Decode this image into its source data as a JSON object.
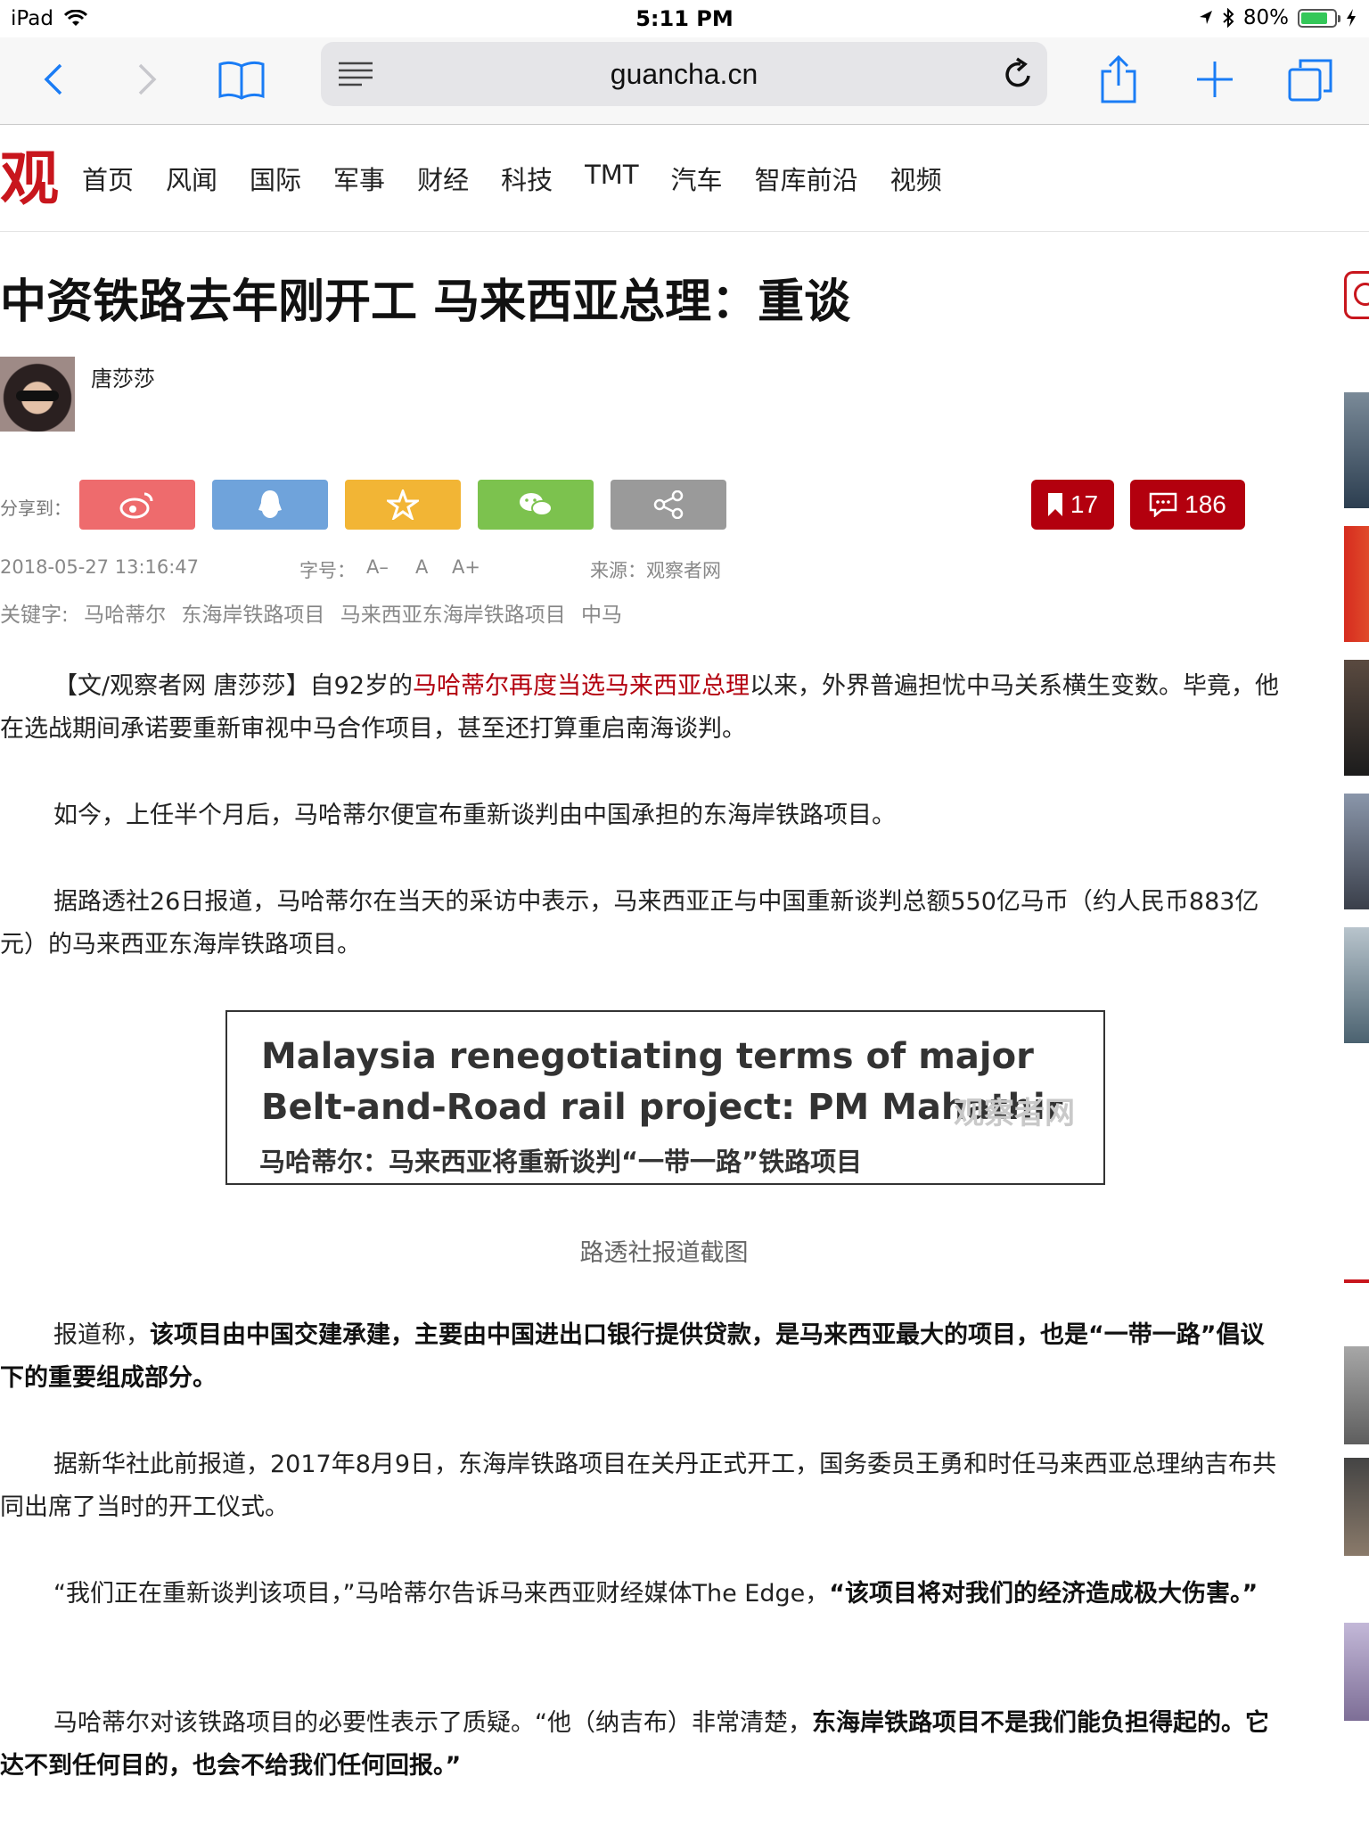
{
  "status_bar": {
    "device": "iPad",
    "time": "5:11 PM",
    "battery": "80%"
  },
  "browser": {
    "url": "guancha.cn"
  },
  "site": {
    "logo_text": "观",
    "nav": [
      "首页",
      "风闻",
      "国际",
      "军事",
      "财经",
      "科技",
      "TMT",
      "汽车",
      "智库前沿",
      "视频"
    ]
  },
  "article": {
    "title": "中资铁路去年刚开工 马来西亚总理：重谈",
    "author": "唐莎莎",
    "share_label": "分享到：",
    "bookmark_count": "17",
    "comment_count": "186",
    "date": "2018-05-27 13:16:47",
    "font_label": "字号：",
    "font_smaller": "A–",
    "font_normal": "A",
    "font_larger": "A+",
    "source": "来源：观察者网",
    "keywords_label": "关键字:",
    "keywords": [
      "马哈蒂尔",
      "东海岸铁路项目",
      "马来西亚东海岸铁路项目",
      "中马"
    ],
    "p1_a": "【文/观察者网 唐莎莎】自92岁的",
    "p1_link": "马哈蒂尔再度当选马来西亚总理",
    "p1_b": "以来，外界普遍担忧中马关系横生变数。毕竟，他在选战期间承诺要重新审视中马合作项目，甚至还打算重启南海谈判。",
    "p2": "如今，上任半个月后，马哈蒂尔便宣布重新谈判由中国承担的东海岸铁路项目。",
    "p3": "据路透社26日报道，马哈蒂尔在当天的采访中表示，马来西亚正与中国重新谈判总额550亿马币（约人民币883亿元）的马来西亚东海岸铁路项目。",
    "figure_en": "Malaysia renegotiating terms of major Belt-and-Road rail project: PM Mahathir",
    "figure_cn": "马哈蒂尔：马来西亚将重新谈判“一带一路”铁路项目",
    "figure_watermark": "观察者网",
    "caption": "路透社报道截图",
    "p4_a": "报道称，",
    "p4_b": "该项目由中国交建承建，主要由中国进出口银行提供贷款，是马来西亚最大的项目，也是“一带一路”倡议下的重要组成部分。",
    "p5": "据新华社此前报道，2017年8月9日，东海岸铁路项目在关丹正式开工，国务委员王勇和时任马来西亚总理纳吉布共同出席了当时的开工仪式。",
    "p6_a": "“我们正在重新谈判该项目，”马哈蒂尔告诉马来西亚财经媒体The Edge，",
    "p6_b": "“该项目将对我们的经济造成极大伤害。”",
    "p7_a": "马哈蒂尔对该铁路项目的必要性表示了质疑。“他（纳吉布）非常清楚，",
    "p7_b": "东海岸铁路项目不是我们能负担得起的。它达不到任何目的，也会不给我们任何回报。”"
  },
  "colors": {
    "brand_red": "#b3000e",
    "weibo": "#ee6b6d",
    "qq": "#6fa3db",
    "qzone": "#f2b535",
    "wechat": "#7cc24e",
    "more": "#9a9a9a"
  },
  "icons": [
    "back-icon",
    "forward-icon",
    "bookmarks-icon",
    "reader-icon",
    "reload-icon",
    "share-icon",
    "add-tab-icon",
    "tabs-icon",
    "weibo-icon",
    "qq-icon",
    "qzone-icon",
    "wechat-icon",
    "share-more-icon",
    "bookmark-icon",
    "comment-icon"
  ]
}
